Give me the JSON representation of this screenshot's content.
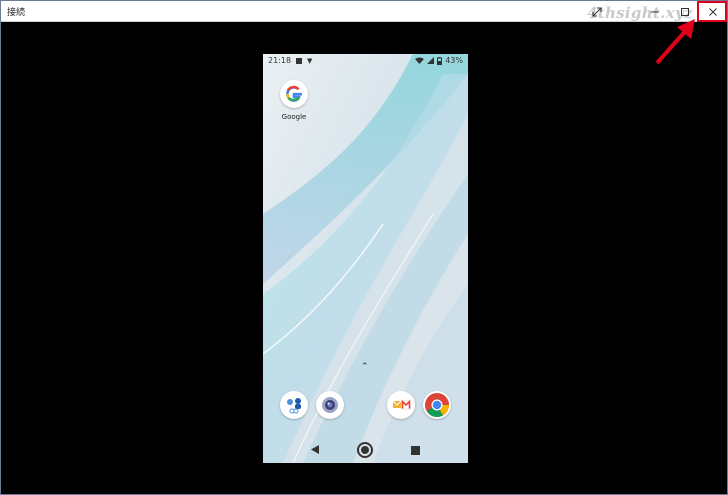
{
  "window": {
    "title": "接続",
    "watermark": "4thsight.xyz"
  },
  "phone": {
    "status": {
      "time": "21:18",
      "battery": "43%"
    },
    "apps": {
      "google_label": "Google"
    }
  },
  "colors": {
    "highlight": "#e0001a",
    "titlebar_bg": "#ffffff",
    "screen_bg": "#000000"
  },
  "icons": [
    "expand-icon",
    "minimize-icon",
    "maximize-icon",
    "close-icon",
    "google-icon",
    "phone-contacts-icon",
    "camera-icon",
    "messages-mail-icon",
    "chrome-icon",
    "back-icon",
    "home-icon",
    "recents-icon"
  ]
}
